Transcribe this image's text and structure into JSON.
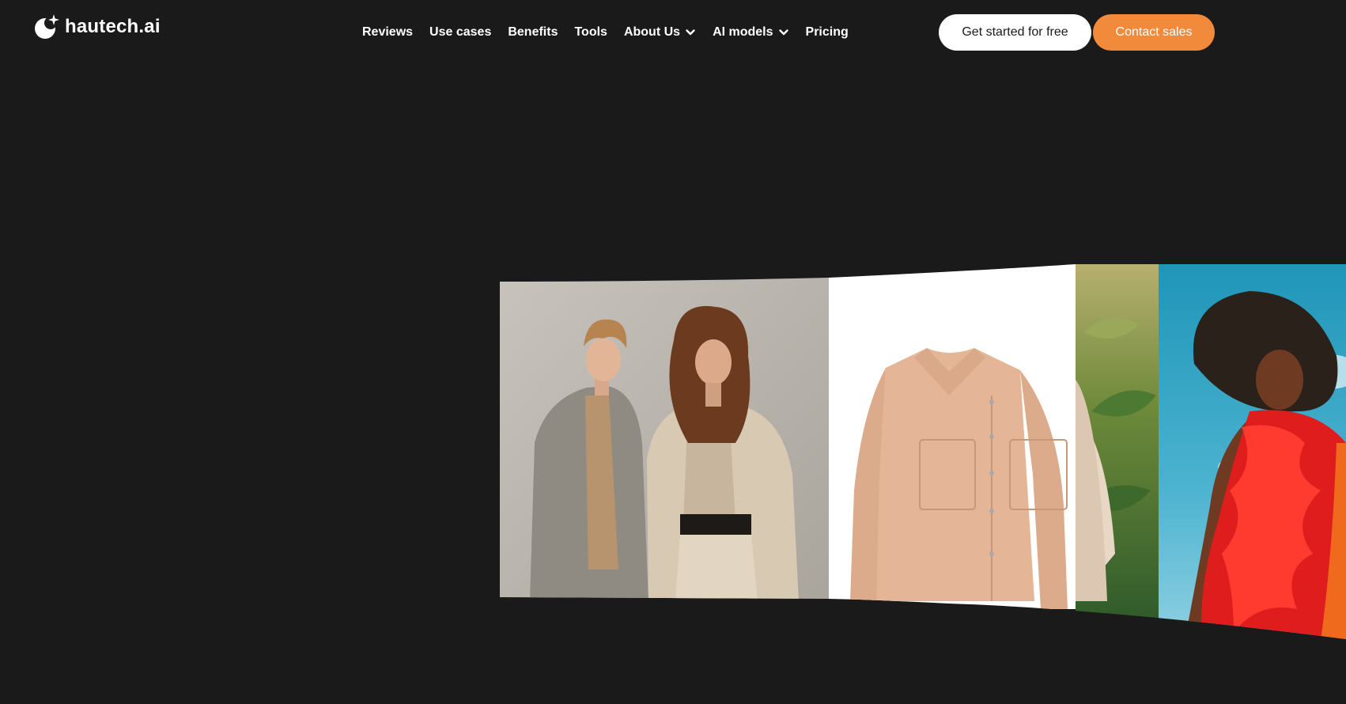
{
  "brand": {
    "name": "hautech.ai",
    "colors": {
      "background": "#1a1a1a",
      "accent": "#f28a3c",
      "text": "#ffffff"
    }
  },
  "nav": {
    "items": [
      {
        "label": "Reviews",
        "dropdown": false
      },
      {
        "label": "Use cases",
        "dropdown": false
      },
      {
        "label": "Benefits",
        "dropdown": false
      },
      {
        "label": "Tools",
        "dropdown": false
      },
      {
        "label": "About Us",
        "dropdown": true
      },
      {
        "label": "AI models",
        "dropdown": true
      },
      {
        "label": "Pricing",
        "dropdown": false
      }
    ],
    "dropdown_icon": "chevron-down-icon"
  },
  "cta": {
    "primary_label": "Get started for free",
    "secondary_label": "Contact sales"
  },
  "gallery": {
    "images": [
      {
        "name": "couple-in-neutral-tailoring-photo"
      },
      {
        "name": "peach-overshirt-product-photo"
      },
      {
        "name": "tropical-foliage-photo"
      },
      {
        "name": "model-in-red-ruffle-dress-photo"
      }
    ]
  }
}
